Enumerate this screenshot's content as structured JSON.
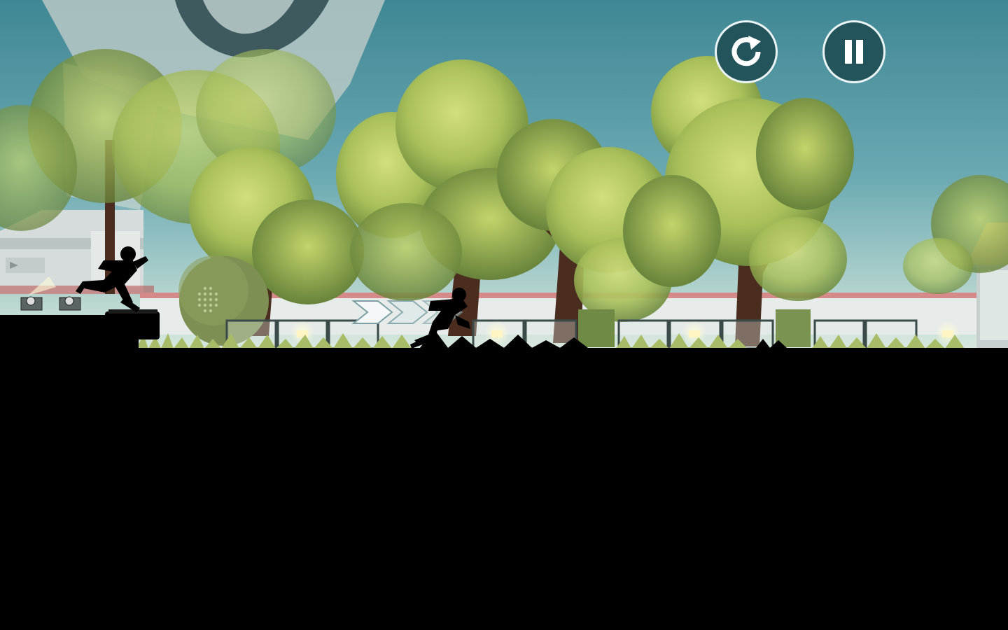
{
  "game": {
    "hud": {
      "restart_icon": "restart-icon",
      "pause_icon": "pause-icon"
    },
    "colors": {
      "sky_top": "#3f8794",
      "sky_bottom": "#d7e8dc",
      "foliage_light": "#b9cc63",
      "foliage_dark": "#5d7a3a",
      "trunk": "#4a2d1e",
      "ground": "#000000",
      "hud_fill": "#23545b",
      "hud_ring": "#eaf4f4",
      "building": "#c8d2d2"
    },
    "entities": {
      "player": "runner-silhouette",
      "chaser": "hunter-silhouette",
      "speed_arrows": "speed-boost-chevrons"
    }
  }
}
